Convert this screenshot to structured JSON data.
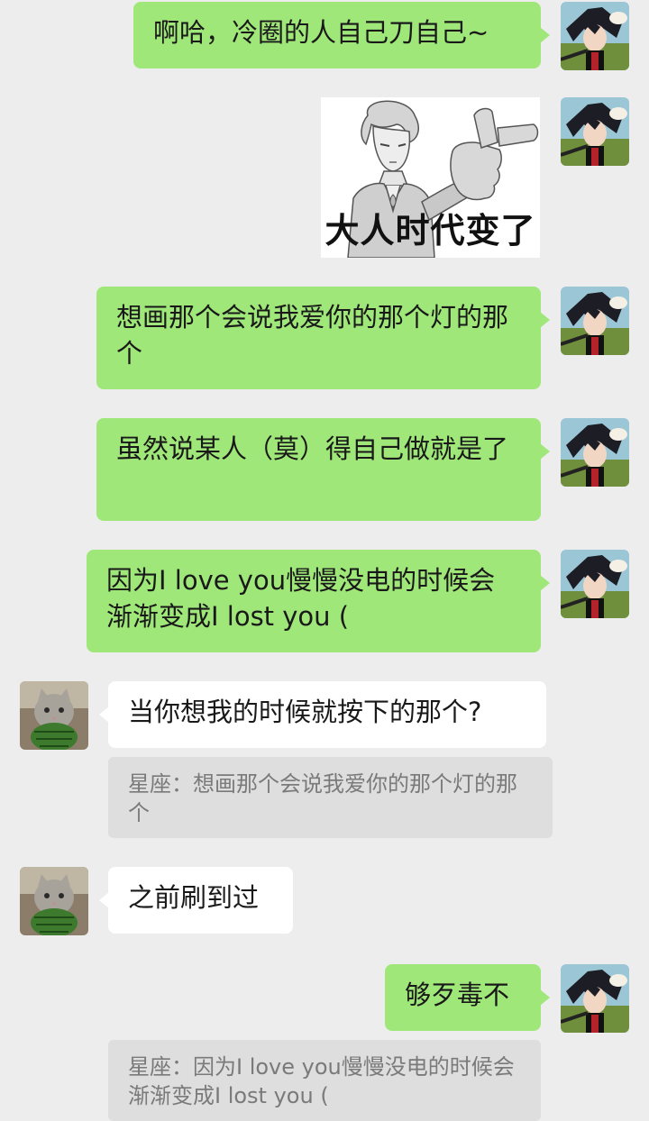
{
  "colors": {
    "background": "#ededed",
    "my_bubble": "#a0e77a",
    "their_bubble": "#ffffff",
    "quote_bg": "#dedede",
    "quote_text": "#7a7a7a"
  },
  "messages": [
    {
      "sender": "me",
      "type": "text",
      "text": "啊哈，冷圈的人自己刀自己~"
    },
    {
      "sender": "me",
      "type": "sticker",
      "caption": "大人时代变了"
    },
    {
      "sender": "me",
      "type": "text",
      "text": "想画那个会说我爱你的那个灯的那个"
    },
    {
      "sender": "me",
      "type": "text",
      "text": "虽然说某人（莫）得自己做就是了"
    },
    {
      "sender": "me",
      "type": "text",
      "text": "因为I love you慢慢没电的时候会渐渐变成I lost you ("
    },
    {
      "sender": "them",
      "type": "text",
      "text": "当你想我的时候就按下的那个?",
      "quote": "星座：想画那个会说我爱你的那个灯的那个"
    },
    {
      "sender": "them",
      "type": "text",
      "text": "之前刷到过"
    },
    {
      "sender": "me",
      "type": "text",
      "text": "够歹毒不",
      "quote": "星座：因为I love you慢慢没电的时候会渐渐变成I lost you ("
    }
  ]
}
